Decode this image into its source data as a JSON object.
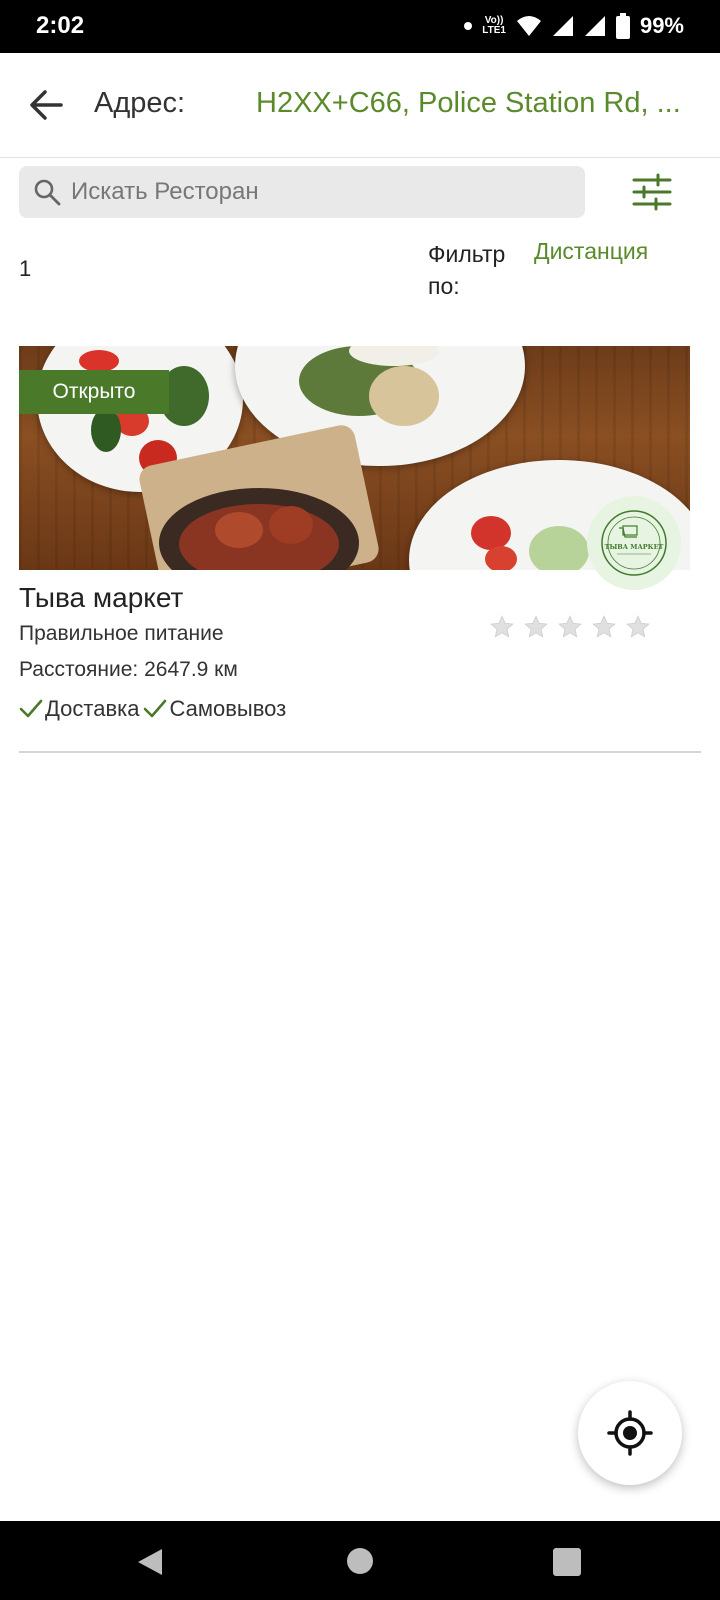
{
  "status_bar": {
    "time": "2:02",
    "network_top": "Vo))",
    "network_bottom": "LTE1",
    "battery": "99%"
  },
  "header": {
    "address_label": "Адрес:",
    "address_value": "H2XX+C66, Police Station Rd, ..."
  },
  "search": {
    "placeholder": "Искать Ресторан"
  },
  "results": {
    "count": "1",
    "filter_label": "Фильтр по:",
    "filter_value": "Дистанция"
  },
  "restaurant": {
    "status": "Открыто",
    "name": "Тыва маркет",
    "category": "Правильное питание",
    "distance": "Расстояние: 2647.9 км",
    "delivery": "Доставка",
    "pickup": "Самовывоз",
    "rating": 0,
    "rating_max": 5,
    "logo_text": "ТЫВА МАРКЕТ"
  },
  "colors": {
    "accent": "#5a8a2b",
    "badge": "#4a7a29"
  },
  "icons": [
    "back-arrow-icon",
    "search-icon",
    "filter-sliders-icon",
    "check-icon",
    "star-icon",
    "my-location-icon"
  ]
}
